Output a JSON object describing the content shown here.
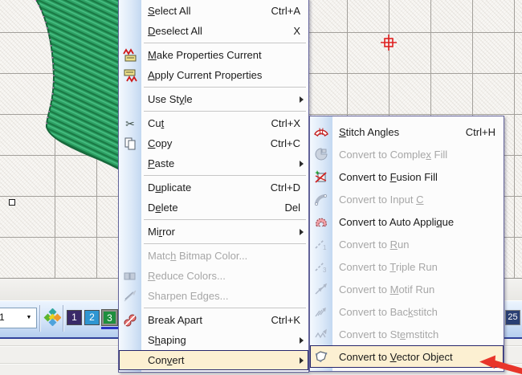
{
  "colors": {
    "highlight_bg": "#FCF0D2",
    "highlight_border": "#26266B",
    "annotation_red": "#E8352A",
    "stitch_green": "#2EA265",
    "grid_line": "#A3A09B",
    "marker_red": "#E02020"
  },
  "main_menu": {
    "items": [
      {
        "name": "select-all",
        "pre": "",
        "u": "S",
        "post": "elect All",
        "shortcut": "Ctrl+A",
        "icon": null,
        "disabled": false,
        "submenu": false,
        "highlight": false
      },
      {
        "name": "deselect-all",
        "pre": "",
        "u": "D",
        "post": "eselect All",
        "shortcut": "X",
        "icon": null,
        "disabled": false,
        "submenu": false,
        "highlight": false
      },
      {
        "type": "sep"
      },
      {
        "name": "make-properties-current",
        "pre": "",
        "u": "M",
        "post": "ake Properties Current",
        "shortcut": "",
        "icon": "make-properties-current",
        "disabled": false,
        "submenu": false,
        "highlight": false
      },
      {
        "name": "apply-current-properties",
        "pre": "",
        "u": "A",
        "post": "pply Current Properties",
        "shortcut": "",
        "icon": "apply-current-properties",
        "disabled": false,
        "submenu": false,
        "highlight": false
      },
      {
        "type": "sep"
      },
      {
        "name": "use-style",
        "pre": "Use St",
        "u": "y",
        "post": "le",
        "shortcut": "",
        "icon": null,
        "disabled": false,
        "submenu": true,
        "highlight": false
      },
      {
        "type": "sep"
      },
      {
        "name": "cut",
        "pre": "Cu",
        "u": "t",
        "post": "",
        "shortcut": "Ctrl+X",
        "icon": "cut",
        "disabled": false,
        "submenu": false,
        "highlight": false
      },
      {
        "name": "copy",
        "pre": "",
        "u": "C",
        "post": "opy",
        "shortcut": "Ctrl+C",
        "icon": "copy",
        "disabled": false,
        "submenu": false,
        "highlight": false
      },
      {
        "name": "paste",
        "pre": "",
        "u": "P",
        "post": "aste",
        "shortcut": "",
        "icon": null,
        "disabled": false,
        "submenu": true,
        "highlight": false
      },
      {
        "type": "sep"
      },
      {
        "name": "duplicate",
        "pre": "D",
        "u": "u",
        "post": "plicate",
        "shortcut": "Ctrl+D",
        "icon": null,
        "disabled": false,
        "submenu": false,
        "highlight": false
      },
      {
        "name": "delete",
        "pre": "D",
        "u": "e",
        "post": "lete",
        "shortcut": "Del",
        "icon": null,
        "disabled": false,
        "submenu": false,
        "highlight": false
      },
      {
        "type": "sep"
      },
      {
        "name": "mirror",
        "pre": "Mi",
        "u": "r",
        "post": "ror",
        "shortcut": "",
        "icon": null,
        "disabled": false,
        "submenu": true,
        "highlight": false
      },
      {
        "type": "sep"
      },
      {
        "name": "match-bitmap-color",
        "pre": "Matc",
        "u": "h",
        "post": " Bitmap Color...",
        "shortcut": "",
        "icon": null,
        "disabled": true,
        "submenu": false,
        "highlight": false
      },
      {
        "name": "reduce-colors",
        "pre": "",
        "u": "R",
        "post": "educe Colors...",
        "shortcut": "",
        "icon": "reduce-colors",
        "disabled": true,
        "submenu": false,
        "highlight": false
      },
      {
        "name": "sharpen-edges",
        "pre": "Sharpen Ed",
        "u": "g",
        "post": "es...",
        "shortcut": "",
        "icon": "sharpen-edges",
        "disabled": true,
        "submenu": false,
        "highlight": false
      },
      {
        "type": "sep"
      },
      {
        "name": "break-apart",
        "pre": "Break Apart",
        "u": "",
        "post": "",
        "shortcut": "Ctrl+K",
        "icon": "break-apart",
        "disabled": false,
        "submenu": false,
        "highlight": false
      },
      {
        "name": "shaping",
        "pre": "S",
        "u": "h",
        "post": "aping",
        "shortcut": "",
        "icon": null,
        "disabled": false,
        "submenu": true,
        "highlight": false
      },
      {
        "name": "convert",
        "pre": "Con",
        "u": "v",
        "post": "ert",
        "shortcut": "",
        "icon": null,
        "disabled": false,
        "submenu": true,
        "highlight": true
      }
    ]
  },
  "convert_submenu": {
    "items": [
      {
        "name": "stitch-angles",
        "pre": "",
        "u": "S",
        "post": "titch Angles",
        "shortcut": "Ctrl+H",
        "icon": "stitch-angles",
        "disabled": false,
        "submenu": false,
        "highlight": false
      },
      {
        "name": "convert-to-complex-fill",
        "pre": "Convert to Comple",
        "u": "x",
        "post": " Fill",
        "shortcut": "",
        "icon": "complex-fill",
        "disabled": true,
        "submenu": false,
        "highlight": false
      },
      {
        "name": "convert-to-fusion-fill",
        "pre": "Convert to ",
        "u": "F",
        "post": "usion Fill",
        "shortcut": "",
        "icon": "fusion-fill",
        "disabled": false,
        "submenu": false,
        "highlight": false
      },
      {
        "name": "convert-to-input-c",
        "pre": "Convert to Input ",
        "u": "C",
        "post": "",
        "shortcut": "",
        "icon": "input-c",
        "disabled": true,
        "submenu": false,
        "highlight": false
      },
      {
        "name": "convert-to-auto-applique",
        "pre": "Convert to Auto Appli",
        "u": "q",
        "post": "ue",
        "shortcut": "",
        "icon": "auto-applique",
        "disabled": false,
        "submenu": false,
        "highlight": false
      },
      {
        "name": "convert-to-run",
        "pre": "Convert to ",
        "u": "R",
        "post": "un",
        "shortcut": "",
        "icon": "run",
        "disabled": true,
        "submenu": false,
        "highlight": false
      },
      {
        "name": "convert-to-triple-run",
        "pre": "Convert to ",
        "u": "T",
        "post": "riple Run",
        "shortcut": "",
        "icon": "triple-run",
        "disabled": true,
        "submenu": false,
        "highlight": false
      },
      {
        "name": "convert-to-motif-run",
        "pre": "Convert to ",
        "u": "M",
        "post": "otif Run",
        "shortcut": "",
        "icon": "motif-run",
        "disabled": true,
        "submenu": false,
        "highlight": false
      },
      {
        "name": "convert-to-backstitch",
        "pre": "Convert to Bac",
        "u": "k",
        "post": "stitch",
        "shortcut": "",
        "icon": "backstitch",
        "disabled": true,
        "submenu": false,
        "highlight": false
      },
      {
        "name": "convert-to-stemstitch",
        "pre": "Convert to St",
        "u": "e",
        "post": "mstitch",
        "shortcut": "",
        "icon": "stemstitch",
        "disabled": true,
        "submenu": false,
        "highlight": false
      },
      {
        "name": "convert-to-vector-object",
        "pre": "Convert to ",
        "u": "V",
        "post": "ector Object",
        "shortcut": "",
        "icon": "vector-object",
        "disabled": false,
        "submenu": false,
        "highlight": true
      }
    ]
  },
  "toolbar": {
    "combo_value": "1",
    "palette": [
      {
        "label": "1",
        "color": "#3A2A68",
        "selected": false
      },
      {
        "label": "2",
        "color": "#2F96D2",
        "selected": false
      },
      {
        "label": "3",
        "color": "#1E8F3E",
        "selected": true
      }
    ],
    "palette_right_label": "25",
    "palette_right_color": "#2A3F73"
  }
}
